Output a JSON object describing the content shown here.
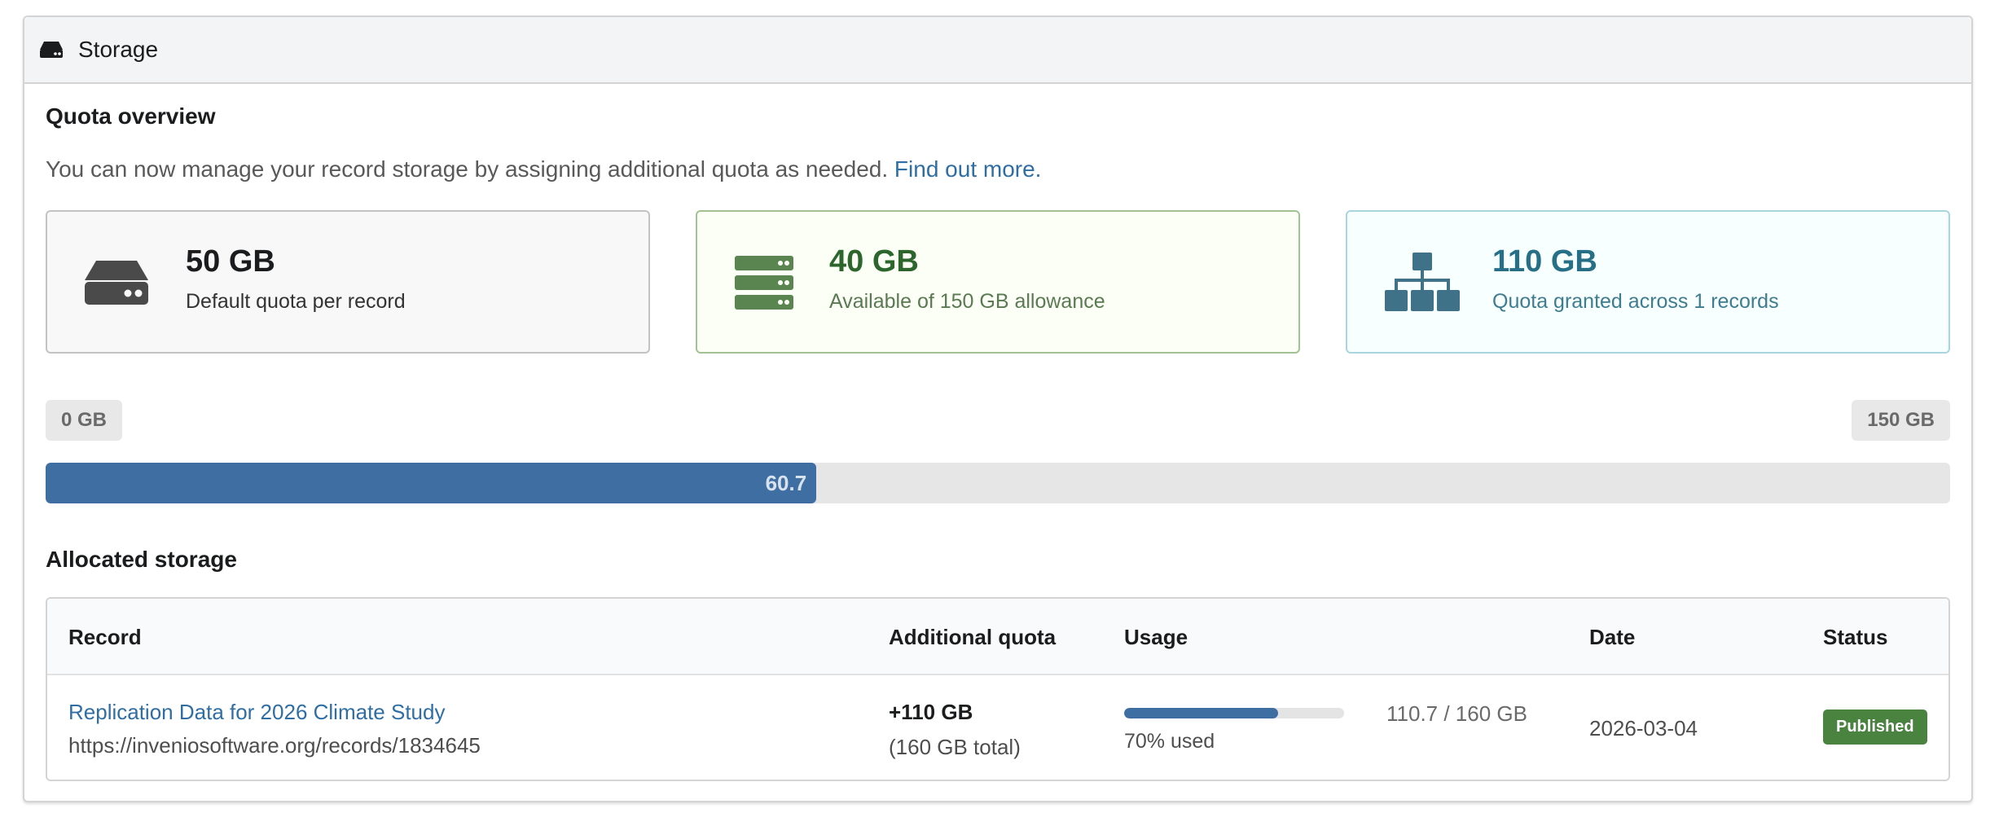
{
  "header": {
    "title": "Storage",
    "icon": "hdd-icon"
  },
  "quota_overview": {
    "title": "Quota overview",
    "intro_text": "You can now manage your record storage by assigning additional quota as needed.",
    "intro_link": "Find out more."
  },
  "cards": {
    "default": {
      "value": "50 GB",
      "label": "Default quota per record",
      "icon": "hdd-icon"
    },
    "available": {
      "value": "40 GB",
      "label": "Available of 150 GB allowance",
      "icon": "server-icon",
      "color": "#2c662d"
    },
    "granted": {
      "value": "110 GB",
      "label": "Quota granted across 1 records",
      "icon": "sitemap-icon",
      "color": "#276f86"
    }
  },
  "allowance_bar": {
    "min_label": "0 GB",
    "max_label": "150 GB",
    "value_label": "60.7",
    "percent": 40.47,
    "color": "#3f6ea3"
  },
  "allocated": {
    "title": "Allocated storage",
    "columns": [
      "Record",
      "Additional quota",
      "Usage",
      "Date",
      "Status"
    ],
    "rows": [
      {
        "record_title": "Replication Data for 2026 Climate Study",
        "record_url": "https://inveniosoftware.org/records/1834645",
        "additional_quota": "+110 GB",
        "total_quota": "(160 GB total)",
        "usage_percent": 70,
        "usage_text": "70% used",
        "usage_ratio": "110.7 / 160 GB",
        "date": "2026-03-04",
        "status": "Published",
        "status_color": "#4a8240"
      }
    ]
  }
}
